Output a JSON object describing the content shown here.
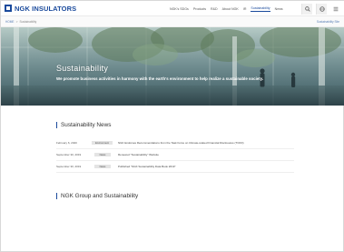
{
  "header": {
    "logo_text": "NGK INSULATORS",
    "nav": [
      {
        "label": "NGK's SDGs"
      },
      {
        "label": "Products"
      },
      {
        "label": "R&D"
      },
      {
        "label": "About NGK"
      },
      {
        "label": "IR"
      },
      {
        "label": "Sustainability",
        "active": true
      },
      {
        "label": "News"
      }
    ],
    "icons": [
      "search-icon",
      "language-icon",
      "menu-icon"
    ]
  },
  "breadcrumb": {
    "home": "HOME",
    "separator": ">",
    "current": "Sustainability",
    "site_link": "Sustainability Site"
  },
  "hero": {
    "title": "Sustainability",
    "subtitle": "We promote business activities in harmony with the earth's environment to help realize a sustainable society."
  },
  "news": {
    "title": "Sustainability News",
    "items": [
      {
        "date": "February 6, 2020",
        "category": "Environment",
        "text": "NGK Endorses Recommendations from the Task Force on Climate-related Financial Disclosures (TCFD)"
      },
      {
        "date": "September 30, 2019",
        "category": "News",
        "text": "Renewed \"Sustainability\" Website"
      },
      {
        "date": "September 30, 2019",
        "category": "News",
        "text": "Published \"NGK Sustainability Data Book 2019\""
      }
    ]
  },
  "group": {
    "title": "NGK Group and Sustainability"
  },
  "colors": {
    "brand": "#1a4a9c",
    "badge_bg": "#e4e4e4"
  }
}
